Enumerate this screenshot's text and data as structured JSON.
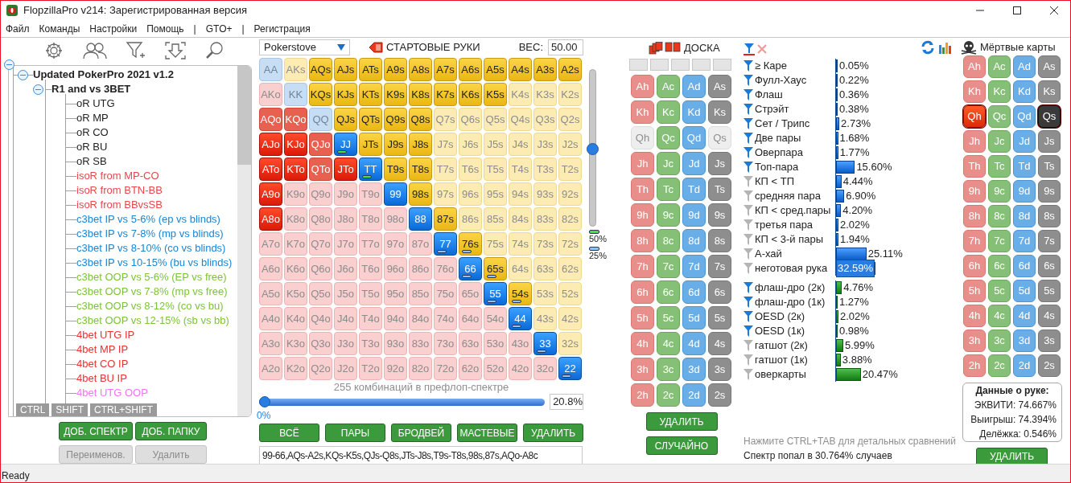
{
  "window": {
    "title": "FlopzillaPro v214: Зарегистрированная версия"
  },
  "menu": [
    "Файл",
    "Команды",
    "Настройки",
    "Помощь",
    "|",
    "GTO+",
    "|",
    "Регистрация"
  ],
  "tree": {
    "expanded": true,
    "children": [
      {
        "label": "Updated PokerPro 2021 v1.2",
        "expanded": true,
        "children": [
          {
            "label": "R1 and vs 3BET",
            "expanded": true,
            "children": [
              {
                "label": "oR UTG",
                "color": "#222222"
              },
              {
                "label": "oR MP",
                "color": "#222222"
              },
              {
                "label": "oR CO",
                "color": "#222222"
              },
              {
                "label": "oR BU",
                "color": "#222222"
              },
              {
                "label": "oR SB",
                "color": "#222222"
              },
              {
                "label": "isoR from MP-CO",
                "color": "#e8474c"
              },
              {
                "label": "isoR from BTN-BB",
                "color": "#e8474c"
              },
              {
                "label": "isoR from BBvsSB",
                "color": "#e8474c"
              },
              {
                "label": "c3bet IP vs 5-6% (ep vs blinds)",
                "color": "#1b85d4"
              },
              {
                "label": "c3bet IP vs 7-8% (mp vs blinds)",
                "color": "#1b85d4"
              },
              {
                "label": "c3bet IP vs 8-10% (co vs blinds)",
                "color": "#1b85d4"
              },
              {
                "label": "c3bet IP vs 10-15% (bu vs blinds)",
                "color": "#1b85d4"
              },
              {
                "label": "c3bet OOP vs 5-6% (EP vs free)",
                "color": "#7cc33a"
              },
              {
                "label": "c3bet OOP vs 7-8% (mp vs free)",
                "color": "#7cc33a"
              },
              {
                "label": "c3bet OOP vs 8-12% (co vs bu)",
                "color": "#7cc33a"
              },
              {
                "label": "c3bet OOP vs 12-15% (sb vs bb)",
                "color": "#7cc33a"
              },
              {
                "label": "4bet UTG IP",
                "color": "#ee3030"
              },
              {
                "label": "4bet MP IP",
                "color": "#ee3030"
              },
              {
                "label": "4bet CO IP",
                "color": "#ee3030"
              },
              {
                "label": "4bet BU IP",
                "color": "#ee3030"
              },
              {
                "label": "4bet UTG OOP",
                "color": "#f075f0"
              }
            ]
          }
        ]
      }
    ]
  },
  "modifier_tabs": [
    "CTRL",
    "SHIFT",
    "CTRL+SHIFT"
  ],
  "tree_buttons": [
    {
      "label": "ДОБ. СПЕКТР",
      "disabled": false
    },
    {
      "label": "ДОБ. ПАПКУ",
      "disabled": false
    },
    {
      "label": "Переименов.",
      "disabled": true
    },
    {
      "label": "Удалить",
      "disabled": true
    }
  ],
  "range": {
    "source": "Pokerstove",
    "title": "СТАРТОВЫЕ РУКИ",
    "weight_label": "ВЕС:",
    "weight": "50.00",
    "matrix": [
      [
        {
          "hand": "AA",
          "selected": false,
          "partial": false
        },
        {
          "hand": "AKs",
          "selected": false,
          "partial": false
        },
        {
          "hand": "AQs",
          "selected": true,
          "partial": false
        },
        {
          "hand": "AJs",
          "selected": true,
          "partial": false
        },
        {
          "hand": "ATs",
          "selected": true,
          "partial": false
        },
        {
          "hand": "A9s",
          "selected": true,
          "partial": false
        },
        {
          "hand": "A8s",
          "selected": true,
          "partial": false
        },
        {
          "hand": "A7s",
          "selected": true,
          "partial": false
        },
        {
          "hand": "A6s",
          "selected": true,
          "partial": false
        },
        {
          "hand": "A5s",
          "selected": true,
          "partial": false
        },
        {
          "hand": "A4s",
          "selected": true,
          "partial": false
        },
        {
          "hand": "A3s",
          "selected": true,
          "partial": false
        },
        {
          "hand": "A2s",
          "selected": true,
          "partial": false
        }
      ],
      [
        {
          "hand": "AKo",
          "selected": false,
          "partial": false
        },
        {
          "hand": "KK",
          "selected": false,
          "partial": false
        },
        {
          "hand": "KQs",
          "selected": true,
          "partial": false
        },
        {
          "hand": "KJs",
          "selected": true,
          "partial": false
        },
        {
          "hand": "KTs",
          "selected": true,
          "partial": false
        },
        {
          "hand": "K9s",
          "selected": true,
          "partial": false
        },
        {
          "hand": "K8s",
          "selected": true,
          "partial": false
        },
        {
          "hand": "K7s",
          "selected": true,
          "partial": false
        },
        {
          "hand": "K6s",
          "selected": true,
          "partial": false
        },
        {
          "hand": "K5s",
          "selected": true,
          "partial": false
        },
        {
          "hand": "K4s",
          "selected": false,
          "partial": false
        },
        {
          "hand": "K3s",
          "selected": false,
          "partial": false
        },
        {
          "hand": "K2s",
          "selected": false,
          "partial": false
        }
      ],
      [
        {
          "hand": "AQo",
          "selected": true,
          "partial": true
        },
        {
          "hand": "KQo",
          "selected": true,
          "partial": true
        },
        {
          "hand": "QQ",
          "selected": false,
          "partial": false
        },
        {
          "hand": "QJs",
          "selected": true,
          "partial": false
        },
        {
          "hand": "QTs",
          "selected": true,
          "partial": false
        },
        {
          "hand": "Q9s",
          "selected": true,
          "partial": false
        },
        {
          "hand": "Q8s",
          "selected": true,
          "partial": false
        },
        {
          "hand": "Q7s",
          "selected": false,
          "partial": false
        },
        {
          "hand": "Q6s",
          "selected": false,
          "partial": false
        },
        {
          "hand": "Q5s",
          "selected": false,
          "partial": false
        },
        {
          "hand": "Q4s",
          "selected": false,
          "partial": false
        },
        {
          "hand": "Q3s",
          "selected": false,
          "partial": false
        },
        {
          "hand": "Q2s",
          "selected": false,
          "partial": false
        }
      ],
      [
        {
          "hand": "AJo",
          "selected": true,
          "partial": false
        },
        {
          "hand": "KJo",
          "selected": true,
          "partial": false
        },
        {
          "hand": "QJo",
          "selected": true,
          "partial": true
        },
        {
          "hand": "JJ",
          "selected": true,
          "partial": false,
          "color": "#3ee83e"
        },
        {
          "hand": "JTs",
          "selected": true,
          "partial": false
        },
        {
          "hand": "J9s",
          "selected": true,
          "partial": false
        },
        {
          "hand": "J8s",
          "selected": true,
          "partial": false
        },
        {
          "hand": "J7s",
          "selected": false,
          "partial": false
        },
        {
          "hand": "J6s",
          "selected": false,
          "partial": false
        },
        {
          "hand": "J5s",
          "selected": false,
          "partial": false
        },
        {
          "hand": "J4s",
          "selected": false,
          "partial": false
        },
        {
          "hand": "J3s",
          "selected": false,
          "partial": false
        },
        {
          "hand": "J2s",
          "selected": false,
          "partial": false
        }
      ],
      [
        {
          "hand": "ATo",
          "selected": true,
          "partial": false
        },
        {
          "hand": "KTo",
          "selected": true,
          "partial": false
        },
        {
          "hand": "QTo",
          "selected": true,
          "partial": true
        },
        {
          "hand": "JTo",
          "selected": true,
          "partial": false
        },
        {
          "hand": "TT",
          "selected": true,
          "partial": false,
          "color": "#3ee83e"
        },
        {
          "hand": "T9s",
          "selected": true,
          "partial": false
        },
        {
          "hand": "T8s",
          "selected": true,
          "partial": false
        },
        {
          "hand": "T7s",
          "selected": false,
          "partial": false
        },
        {
          "hand": "T6s",
          "selected": false,
          "partial": false
        },
        {
          "hand": "T5s",
          "selected": false,
          "partial": false
        },
        {
          "hand": "T4s",
          "selected": false,
          "partial": false
        },
        {
          "hand": "T3s",
          "selected": false,
          "partial": false
        },
        {
          "hand": "T2s",
          "selected": false,
          "partial": false
        }
      ],
      [
        {
          "hand": "A9o",
          "selected": true,
          "partial": false
        },
        {
          "hand": "K9o",
          "selected": false,
          "partial": false
        },
        {
          "hand": "Q9o",
          "selected": false,
          "partial": false
        },
        {
          "hand": "J9o",
          "selected": false,
          "partial": false
        },
        {
          "hand": "T9o",
          "selected": false,
          "partial": false
        },
        {
          "hand": "99",
          "selected": true,
          "partial": false
        },
        {
          "hand": "98s",
          "selected": true,
          "partial": false
        },
        {
          "hand": "97s",
          "selected": false,
          "partial": false
        },
        {
          "hand": "96s",
          "selected": false,
          "partial": false
        },
        {
          "hand": "95s",
          "selected": false,
          "partial": false
        },
        {
          "hand": "94s",
          "selected": false,
          "partial": false
        },
        {
          "hand": "93s",
          "selected": false,
          "partial": false
        },
        {
          "hand": "92s",
          "selected": false,
          "partial": false
        }
      ],
      [
        {
          "hand": "A8o",
          "selected": true,
          "partial": false
        },
        {
          "hand": "K8o",
          "selected": false,
          "partial": false
        },
        {
          "hand": "Q8o",
          "selected": false,
          "partial": false
        },
        {
          "hand": "J8o",
          "selected": false,
          "partial": false
        },
        {
          "hand": "T8o",
          "selected": false,
          "partial": false
        },
        {
          "hand": "98o",
          "selected": false,
          "partial": false
        },
        {
          "hand": "88",
          "selected": true,
          "partial": false
        },
        {
          "hand": "87s",
          "selected": true,
          "partial": false
        },
        {
          "hand": "86s",
          "selected": false,
          "partial": false
        },
        {
          "hand": "85s",
          "selected": false,
          "partial": false
        },
        {
          "hand": "84s",
          "selected": false,
          "partial": false
        },
        {
          "hand": "83s",
          "selected": false,
          "partial": false
        },
        {
          "hand": "82s",
          "selected": false,
          "partial": false
        }
      ],
      [
        {
          "hand": "A7o",
          "selected": false,
          "partial": false
        },
        {
          "hand": "K7o",
          "selected": false,
          "partial": false
        },
        {
          "hand": "Q7o",
          "selected": false,
          "partial": false
        },
        {
          "hand": "J7o",
          "selected": false,
          "partial": false
        },
        {
          "hand": "T7o",
          "selected": false,
          "partial": false
        },
        {
          "hand": "97o",
          "selected": false,
          "partial": false
        },
        {
          "hand": "87o",
          "selected": false,
          "partial": false
        },
        {
          "hand": "77",
          "selected": true,
          "partial": false,
          "color": "#8cc4f4"
        },
        {
          "hand": "76s",
          "selected": true,
          "partial": false,
          "color": "#8cc4f4"
        },
        {
          "hand": "75s",
          "selected": false,
          "partial": false
        },
        {
          "hand": "74s",
          "selected": false,
          "partial": false
        },
        {
          "hand": "73s",
          "selected": false,
          "partial": false
        },
        {
          "hand": "72s",
          "selected": false,
          "partial": false
        }
      ],
      [
        {
          "hand": "A6o",
          "selected": false,
          "partial": false
        },
        {
          "hand": "K6o",
          "selected": false,
          "partial": false
        },
        {
          "hand": "Q6o",
          "selected": false,
          "partial": false
        },
        {
          "hand": "J6o",
          "selected": false,
          "partial": false
        },
        {
          "hand": "T6o",
          "selected": false,
          "partial": false
        },
        {
          "hand": "96o",
          "selected": false,
          "partial": false
        },
        {
          "hand": "86o",
          "selected": false,
          "partial": false
        },
        {
          "hand": "76o",
          "selected": false,
          "partial": false
        },
        {
          "hand": "66",
          "selected": true,
          "partial": false,
          "color": "#8cc4f4"
        },
        {
          "hand": "65s",
          "selected": true,
          "partial": false,
          "color": "#8cc4f4"
        },
        {
          "hand": "64s",
          "selected": false,
          "partial": false
        },
        {
          "hand": "63s",
          "selected": false,
          "partial": false
        },
        {
          "hand": "62s",
          "selected": false,
          "partial": false
        }
      ],
      [
        {
          "hand": "A5o",
          "selected": false,
          "partial": false
        },
        {
          "hand": "K5o",
          "selected": false,
          "partial": false
        },
        {
          "hand": "Q5o",
          "selected": false,
          "partial": false
        },
        {
          "hand": "J5o",
          "selected": false,
          "partial": false
        },
        {
          "hand": "T5o",
          "selected": false,
          "partial": false
        },
        {
          "hand": "95o",
          "selected": false,
          "partial": false
        },
        {
          "hand": "85o",
          "selected": false,
          "partial": false
        },
        {
          "hand": "75o",
          "selected": false,
          "partial": false
        },
        {
          "hand": "65o",
          "selected": false,
          "partial": false
        },
        {
          "hand": "55",
          "selected": true,
          "partial": false,
          "color": "#8cc4f4"
        },
        {
          "hand": "54s",
          "selected": true,
          "partial": false,
          "color": "#8cc4f4"
        },
        {
          "hand": "53s",
          "selected": false,
          "partial": false
        },
        {
          "hand": "52s",
          "selected": false,
          "partial": false
        }
      ],
      [
        {
          "hand": "A4o",
          "selected": false,
          "partial": false
        },
        {
          "hand": "K4o",
          "selected": false,
          "partial": false
        },
        {
          "hand": "Q4o",
          "selected": false,
          "partial": false
        },
        {
          "hand": "J4o",
          "selected": false,
          "partial": false
        },
        {
          "hand": "T4o",
          "selected": false,
          "partial": false
        },
        {
          "hand": "94o",
          "selected": false,
          "partial": false
        },
        {
          "hand": "84o",
          "selected": false,
          "partial": false
        },
        {
          "hand": "74o",
          "selected": false,
          "partial": false
        },
        {
          "hand": "64o",
          "selected": false,
          "partial": false
        },
        {
          "hand": "54o",
          "selected": false,
          "partial": false
        },
        {
          "hand": "44",
          "selected": true,
          "partial": false,
          "color": "#8cc4f4"
        },
        {
          "hand": "43s",
          "selected": false,
          "partial": false
        },
        {
          "hand": "42s",
          "selected": false,
          "partial": false
        }
      ],
      [
        {
          "hand": "A3o",
          "selected": false,
          "partial": false
        },
        {
          "hand": "K3o",
          "selected": false,
          "partial": false
        },
        {
          "hand": "Q3o",
          "selected": false,
          "partial": false
        },
        {
          "hand": "J3o",
          "selected": false,
          "partial": false
        },
        {
          "hand": "T3o",
          "selected": false,
          "partial": false
        },
        {
          "hand": "93o",
          "selected": false,
          "partial": false
        },
        {
          "hand": "83o",
          "selected": false,
          "partial": false
        },
        {
          "hand": "73o",
          "selected": false,
          "partial": false
        },
        {
          "hand": "63o",
          "selected": false,
          "partial": false
        },
        {
          "hand": "53o",
          "selected": false,
          "partial": false
        },
        {
          "hand": "43o",
          "selected": false,
          "partial": false
        },
        {
          "hand": "33",
          "selected": true,
          "partial": false,
          "color": "#8cc4f4"
        },
        {
          "hand": "32s",
          "selected": false,
          "partial": false
        }
      ],
      [
        {
          "hand": "A2o",
          "selected": false,
          "partial": false
        },
        {
          "hand": "K2o",
          "selected": false,
          "partial": false
        },
        {
          "hand": "Q2o",
          "selected": false,
          "partial": false
        },
        {
          "hand": "J2o",
          "selected": false,
          "partial": false
        },
        {
          "hand": "T2o",
          "selected": false,
          "partial": false
        },
        {
          "hand": "92o",
          "selected": false,
          "partial": false
        },
        {
          "hand": "82o",
          "selected": false,
          "partial": false
        },
        {
          "hand": "72o",
          "selected": false,
          "partial": false
        },
        {
          "hand": "62o",
          "selected": false,
          "partial": false
        },
        {
          "hand": "52o",
          "selected": false,
          "partial": false
        },
        {
          "hand": "42o",
          "selected": false,
          "partial": false
        },
        {
          "hand": "32o",
          "selected": false,
          "partial": false
        },
        {
          "hand": "22",
          "selected": true,
          "partial": false,
          "color": "#8cc4f4"
        }
      ]
    ],
    "weight_slider": {
      "level": 0.5
    },
    "legend": [
      {
        "color": "#3ee83e",
        "label": "50%"
      },
      {
        "color": "#8cc4f4",
        "label": "25%"
      }
    ],
    "combos": "255 комбинаций в префлоп-спектре",
    "percent_slider": {
      "level": 0,
      "label": "0%",
      "value": "20.8%"
    },
    "buttons": [
      "ВСЁ",
      "ПАРЫ",
      "БРОДВЕЙ",
      "МАСТЕВЫЕ",
      "УДАЛИТЬ"
    ],
    "text": "99-66,AQs-A2s,KQs-K5s,QJs-Q8s,JTs-J8s,T9s-T8s,98s,87s,AQo-A8c"
  },
  "board": {
    "title": "ДОСКА",
    "cards": [
      [
        {
          "label": "Ah",
          "disabled": false
        },
        {
          "label": "Ac",
          "disabled": false
        },
        {
          "label": "Ad",
          "disabled": false
        },
        {
          "label": "As",
          "disabled": false
        }
      ],
      [
        {
          "label": "Kh",
          "disabled": false
        },
        {
          "label": "Kc",
          "disabled": false
        },
        {
          "label": "Kd",
          "disabled": false
        },
        {
          "label": "Ks",
          "disabled": false
        }
      ],
      [
        {
          "label": "Qh",
          "disabled": true
        },
        {
          "label": "Qc",
          "disabled": false
        },
        {
          "label": "Qd",
          "disabled": false
        },
        {
          "label": "Qs",
          "disabled": true
        }
      ],
      [
        {
          "label": "Jh",
          "disabled": false
        },
        {
          "label": "Jc",
          "disabled": false
        },
        {
          "label": "Jd",
          "disabled": false
        },
        {
          "label": "Js",
          "disabled": false
        }
      ],
      [
        {
          "label": "Th",
          "disabled": false
        },
        {
          "label": "Tc",
          "disabled": false
        },
        {
          "label": "Td",
          "disabled": false
        },
        {
          "label": "Ts",
          "disabled": false
        }
      ],
      [
        {
          "label": "9h",
          "disabled": false
        },
        {
          "label": "9c",
          "disabled": false
        },
        {
          "label": "9d",
          "disabled": false
        },
        {
          "label": "9s",
          "disabled": false
        }
      ],
      [
        {
          "label": "8h",
          "disabled": false
        },
        {
          "label": "8c",
          "disabled": false
        },
        {
          "label": "8d",
          "disabled": false
        },
        {
          "label": "8s",
          "disabled": false
        }
      ],
      [
        {
          "label": "7h",
          "disabled": false
        },
        {
          "label": "7c",
          "disabled": false
        },
        {
          "label": "7d",
          "disabled": false
        },
        {
          "label": "7s",
          "disabled": false
        }
      ],
      [
        {
          "label": "6h",
          "disabled": false
        },
        {
          "label": "6c",
          "disabled": false
        },
        {
          "label": "6d",
          "disabled": false
        },
        {
          "label": "6s",
          "disabled": false
        }
      ],
      [
        {
          "label": "5h",
          "disabled": false
        },
        {
          "label": "5c",
          "disabled": false
        },
        {
          "label": "5d",
          "disabled": false
        },
        {
          "label": "5s",
          "disabled": false
        }
      ],
      [
        {
          "label": "4h",
          "disabled": false
        },
        {
          "label": "4c",
          "disabled": false
        },
        {
          "label": "4d",
          "disabled": false
        },
        {
          "label": "4s",
          "disabled": false
        }
      ],
      [
        {
          "label": "3h",
          "disabled": false
        },
        {
          "label": "3c",
          "disabled": false
        },
        {
          "label": "3d",
          "disabled": false
        },
        {
          "label": "3s",
          "disabled": false
        }
      ],
      [
        {
          "label": "2h",
          "disabled": false
        },
        {
          "label": "2c",
          "disabled": false
        },
        {
          "label": "2d",
          "disabled": false
        },
        {
          "label": "2s",
          "disabled": false
        }
      ]
    ],
    "buttons": [
      "УДАЛИТЬ",
      "СЛУЧАЙНО"
    ]
  },
  "stats": {
    "made_hands": [
      {
        "label": "≥ Каре",
        "active": true,
        "level": 0.0005,
        "value": "0.05%",
        "selected": false
      },
      {
        "label": "Фулл-Хаус",
        "active": true,
        "level": 0.0022,
        "value": "0.22%",
        "selected": false
      },
      {
        "label": "Флаш",
        "active": true,
        "level": 0.0036,
        "value": "0.36%",
        "selected": false
      },
      {
        "label": "Стрэйт",
        "active": true,
        "level": 0.0038,
        "value": "0.38%",
        "selected": false
      },
      {
        "label": "Сет / Трипс",
        "active": true,
        "level": 0.0273,
        "value": "2.73%",
        "selected": false
      },
      {
        "label": "Две пары",
        "active": true,
        "level": 0.0168,
        "value": "1.68%",
        "selected": false
      },
      {
        "label": "Оверпара",
        "active": true,
        "level": 0.0177,
        "value": "1.77%",
        "selected": false
      },
      {
        "label": "Топ-пара",
        "active": true,
        "level": 0.156,
        "value": "15.60%",
        "selected": false
      },
      {
        "label": "КП < ТП",
        "active": false,
        "level": 0.0444,
        "value": "4.44%",
        "selected": false
      },
      {
        "label": "средняя пара",
        "active": false,
        "level": 0.069,
        "value": "6.90%",
        "selected": false
      },
      {
        "label": "КП < сред.пары",
        "active": false,
        "level": 0.042,
        "value": "4.20%",
        "selected": false
      },
      {
        "label": "третья пара",
        "active": false,
        "level": 0.0202,
        "value": "2.02%",
        "selected": false
      },
      {
        "label": "КП < 3-й пары",
        "active": false,
        "level": 0.0194,
        "value": "1.94%",
        "selected": false
      },
      {
        "label": "А-хай",
        "active": false,
        "level": 0.2511,
        "value": "25.11%",
        "selected": false
      },
      {
        "label": "неготовая рука",
        "active": false,
        "level": 0.3259,
        "value": "32.59%",
        "selected": true
      }
    ],
    "draws": [
      {
        "label": "флаш-дро (2к)",
        "active": true,
        "level": 0.0476,
        "value": "4.76%",
        "selected": false
      },
      {
        "label": "флаш-дро (1к)",
        "active": true,
        "level": 0.0127,
        "value": "1.27%",
        "selected": false
      },
      {
        "label": "OESD (2к)",
        "active": true,
        "level": 0.0202,
        "value": "2.02%",
        "selected": false
      },
      {
        "label": "OESD (1к)",
        "active": true,
        "level": 0.0098,
        "value": "0.98%",
        "selected": false
      },
      {
        "label": "гатшот (2к)",
        "active": false,
        "level": 0.0599,
        "value": "5.99%",
        "selected": false
      },
      {
        "label": "гатшот (1к)",
        "active": false,
        "level": 0.0388,
        "value": "3.88%",
        "selected": false
      },
      {
        "label": "оверкарты",
        "active": false,
        "level": 0.2047,
        "value": "20.47%",
        "selected": false
      }
    ],
    "hint": "Нажмите CTRL+TAB для детальных сравнений",
    "hit": "Спектр попал в 30.764% случаев"
  },
  "dead_cards": {
    "title": "Мёртвые карты",
    "cards": [
      [
        {
          "label": "Ah",
          "selected": false
        },
        {
          "label": "Ac",
          "selected": false
        },
        {
          "label": "Ad",
          "selected": false
        },
        {
          "label": "As",
          "selected": false
        }
      ],
      [
        {
          "label": "Kh",
          "selected": false
        },
        {
          "label": "Kc",
          "selected": false
        },
        {
          "label": "Kd",
          "selected": false
        },
        {
          "label": "Ks",
          "selected": false
        }
      ],
      [
        {
          "label": "Qh",
          "selected": true
        },
        {
          "label": "Qc",
          "selected": false
        },
        {
          "label": "Qd",
          "selected": false
        },
        {
          "label": "Qs",
          "selected": true
        }
      ],
      [
        {
          "label": "Jh",
          "selected": false
        },
        {
          "label": "Jc",
          "selected": false
        },
        {
          "label": "Jd",
          "selected": false
        },
        {
          "label": "Js",
          "selected": false
        }
      ],
      [
        {
          "label": "Th",
          "selected": false
        },
        {
          "label": "Tc",
          "selected": false
        },
        {
          "label": "Td",
          "selected": false
        },
        {
          "label": "Ts",
          "selected": false
        }
      ],
      [
        {
          "label": "9h",
          "selected": false
        },
        {
          "label": "9c",
          "selected": false
        },
        {
          "label": "9d",
          "selected": false
        },
        {
          "label": "9s",
          "selected": false
        }
      ],
      [
        {
          "label": "8h",
          "selected": false
        },
        {
          "label": "8c",
          "selected": false
        },
        {
          "label": "8d",
          "selected": false
        },
        {
          "label": "8s",
          "selected": false
        }
      ],
      [
        {
          "label": "7h",
          "selected": false
        },
        {
          "label": "7c",
          "selected": false
        },
        {
          "label": "7d",
          "selected": false
        },
        {
          "label": "7s",
          "selected": false
        }
      ],
      [
        {
          "label": "6h",
          "selected": false
        },
        {
          "label": "6c",
          "selected": false
        },
        {
          "label": "6d",
          "selected": false
        },
        {
          "label": "6s",
          "selected": false
        }
      ],
      [
        {
          "label": "5h",
          "selected": false
        },
        {
          "label": "5c",
          "selected": false
        },
        {
          "label": "5d",
          "selected": false
        },
        {
          "label": "5s",
          "selected": false
        }
      ],
      [
        {
          "label": "4h",
          "selected": false
        },
        {
          "label": "4c",
          "selected": false
        },
        {
          "label": "4d",
          "selected": false
        },
        {
          "label": "4s",
          "selected": false
        }
      ],
      [
        {
          "label": "3h",
          "selected": false
        },
        {
          "label": "3c",
          "selected": false
        },
        {
          "label": "3d",
          "selected": false
        },
        {
          "label": "3s",
          "selected": false
        }
      ],
      [
        {
          "label": "2h",
          "selected": false
        },
        {
          "label": "2c",
          "selected": false
        },
        {
          "label": "2d",
          "selected": false
        },
        {
          "label": "2s",
          "selected": false
        }
      ]
    ]
  },
  "hand_info": {
    "title": "Данные о руке:",
    "lines": [
      "ЭКВИТИ: 74.667%",
      "Выигрыш: 74.394%",
      "Делёжка: 0.546%"
    ]
  },
  "dead_button": "УДАЛИТЬ",
  "status_bar": "Ready"
}
